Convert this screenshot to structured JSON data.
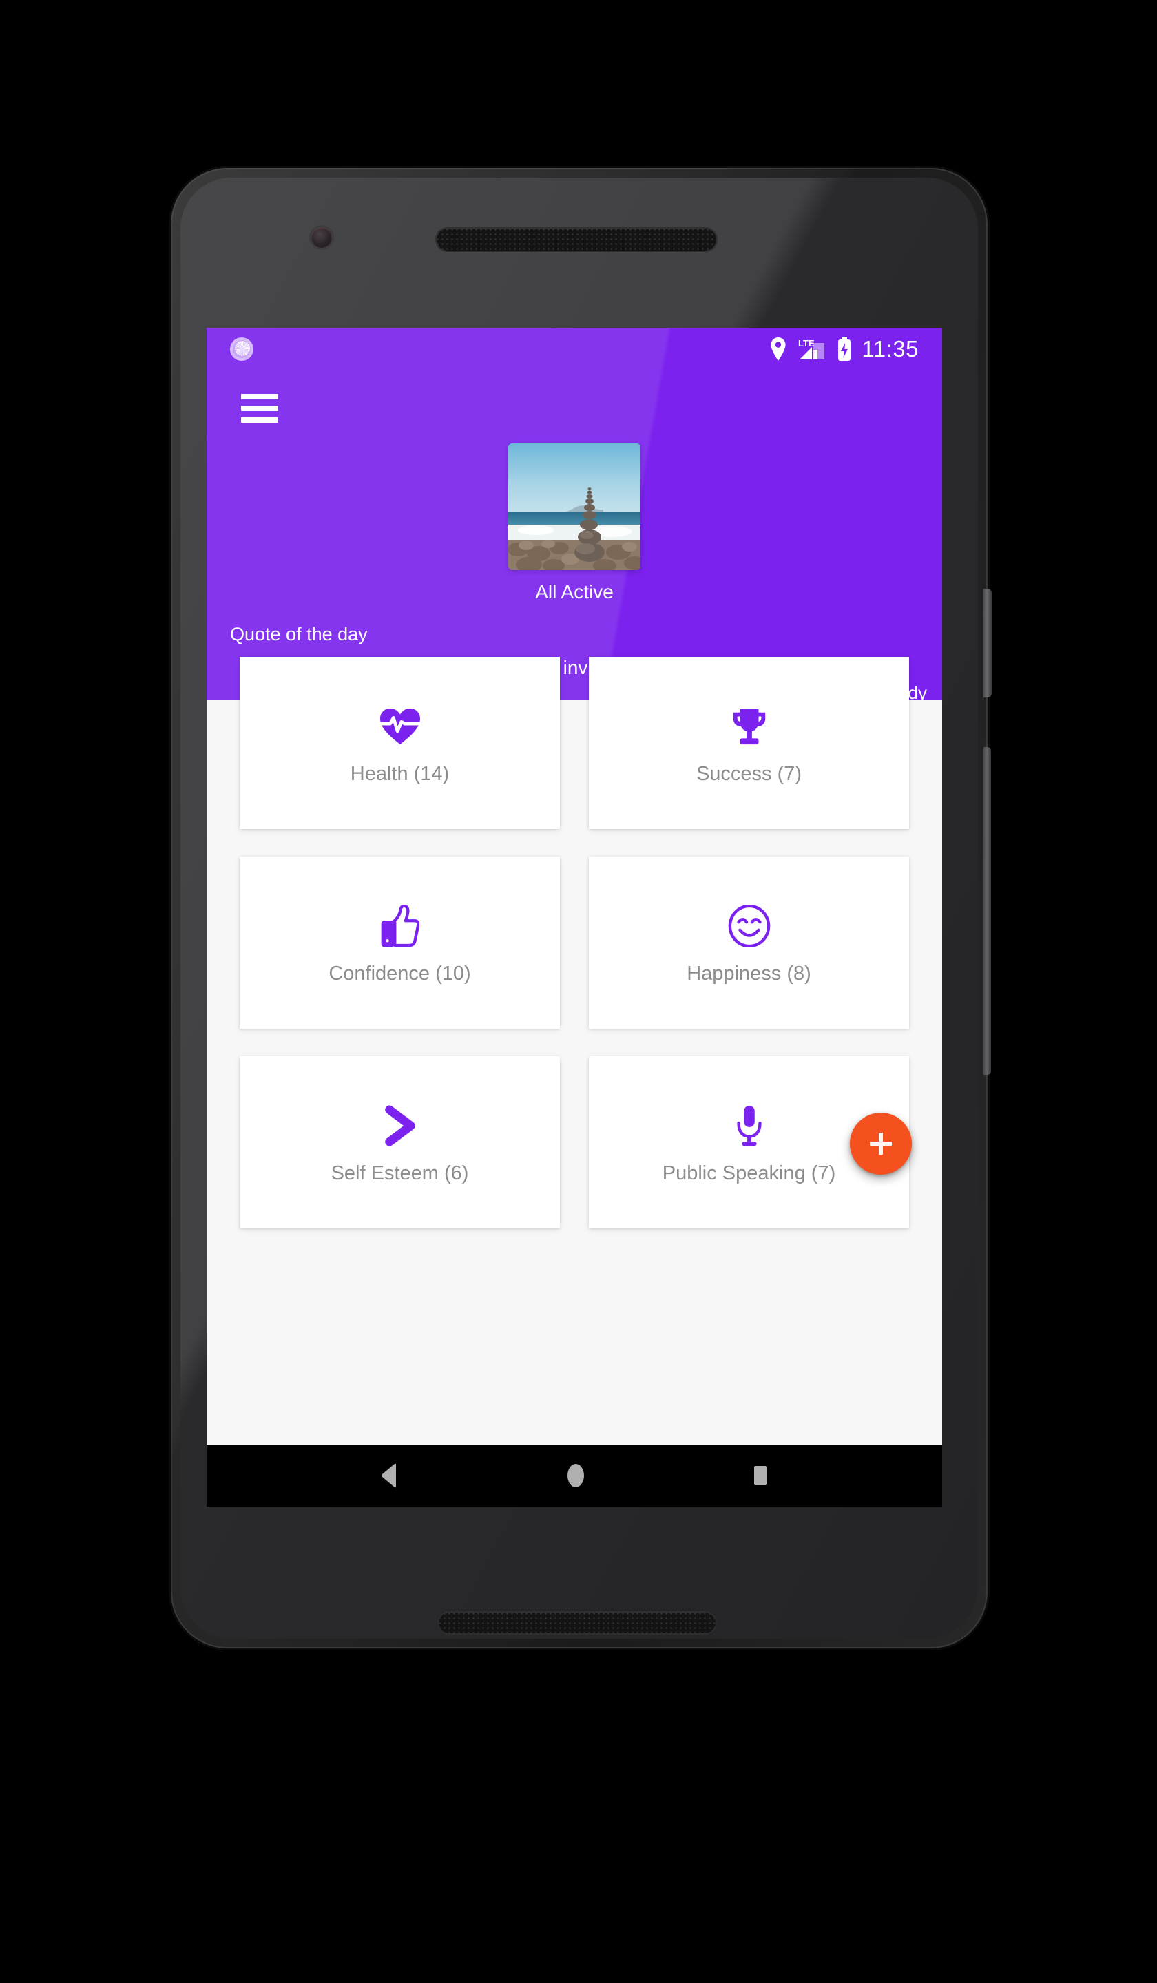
{
  "device": {
    "kind": "android-phone-mockup",
    "frame_color": "#242424"
  },
  "status_bar": {
    "notification_icon": "app-circle-icon",
    "location_icon": "location-pin-icon",
    "network_label": "LTE",
    "signal_icon": "signal-bars-icon",
    "battery_icon": "battery-charging-icon",
    "time": "11:35"
  },
  "app_bar": {
    "menu_icon": "hamburger-menu-icon",
    "background_color": "#7B22EE"
  },
  "hero": {
    "image_alt": "stacked-stones-beach-photo",
    "title": "All Active"
  },
  "quote": {
    "label": "Quote of the day",
    "text": "I awake invigorated",
    "author": "Dana Mundy"
  },
  "grid": {
    "accent_color": "#7B22EE",
    "label_color": "#8c8c8c",
    "cards": [
      {
        "label": "Health (14)",
        "icon": "heartbeat-icon",
        "name": "Health",
        "count": 14
      },
      {
        "label": "Success (7)",
        "icon": "trophy-icon",
        "name": "Success",
        "count": 7
      },
      {
        "label": "Confidence (10)",
        "icon": "thumbs-up-icon",
        "name": "Confidence",
        "count": 10
      },
      {
        "label": "Happiness (8)",
        "icon": "smiley-face-icon",
        "name": "Happiness",
        "count": 8
      },
      {
        "label": "Self Esteem (6)",
        "icon": "chevron-right-icon",
        "name": "Self Esteem",
        "count": 6
      },
      {
        "label": "Public Speaking (7)",
        "icon": "microphone-icon",
        "name": "Public Speaking",
        "count": 7
      }
    ]
  },
  "fab": {
    "icon": "plus-icon",
    "color": "#F4511E",
    "label": "+"
  },
  "nav_bar": {
    "back_icon": "back-triangle-icon",
    "home_icon": "home-circle-icon",
    "recents_icon": "recents-square-icon"
  }
}
